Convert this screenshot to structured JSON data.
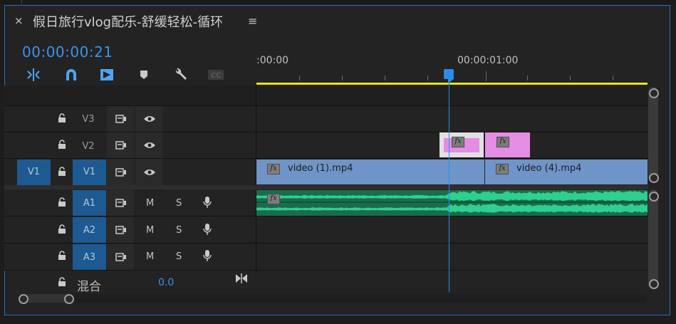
{
  "window": {
    "close_glyph": "×",
    "title": "假日旅行vlog配乐-舒缓轻松-循环",
    "menu_glyph": "≡"
  },
  "timecode": "00:00:00:21",
  "toolbar": {
    "tools": [
      "snap-insert-icon",
      "magnet-snap-icon",
      "linked-selection-icon",
      "add-marker-icon",
      "wrench-settings-icon",
      "captions-icon"
    ]
  },
  "ruler": {
    "labels": [
      ":00:00",
      "00:00:01:00"
    ]
  },
  "tracks": {
    "video": [
      {
        "name": "V3",
        "source": ""
      },
      {
        "name": "V2",
        "source": ""
      },
      {
        "name": "V1",
        "source": "V1"
      }
    ],
    "audio": [
      {
        "name": "A1",
        "m": "M",
        "s": "S"
      },
      {
        "name": "A2",
        "m": "M",
        "s": "S"
      },
      {
        "name": "A3",
        "m": "M",
        "s": "S"
      }
    ],
    "mix": {
      "label": "混合",
      "value": "0.0"
    }
  },
  "clips": {
    "v1_a": {
      "label": "video (1).mp4",
      "fx": "fx"
    },
    "v1_b": {
      "label": "video (4).mp4",
      "fx": "fx"
    },
    "v2_a": {
      "fx": "fx"
    },
    "v2_b": {
      "fx": "fx"
    },
    "a1": {
      "fx": "fx"
    }
  },
  "colors": {
    "accent": "#2d8ceb",
    "video_clip": "#6f94c8",
    "pink_clip": "#e58ce4",
    "audio_clip": "#1b6b4d",
    "work_area": "#e8e01e"
  }
}
